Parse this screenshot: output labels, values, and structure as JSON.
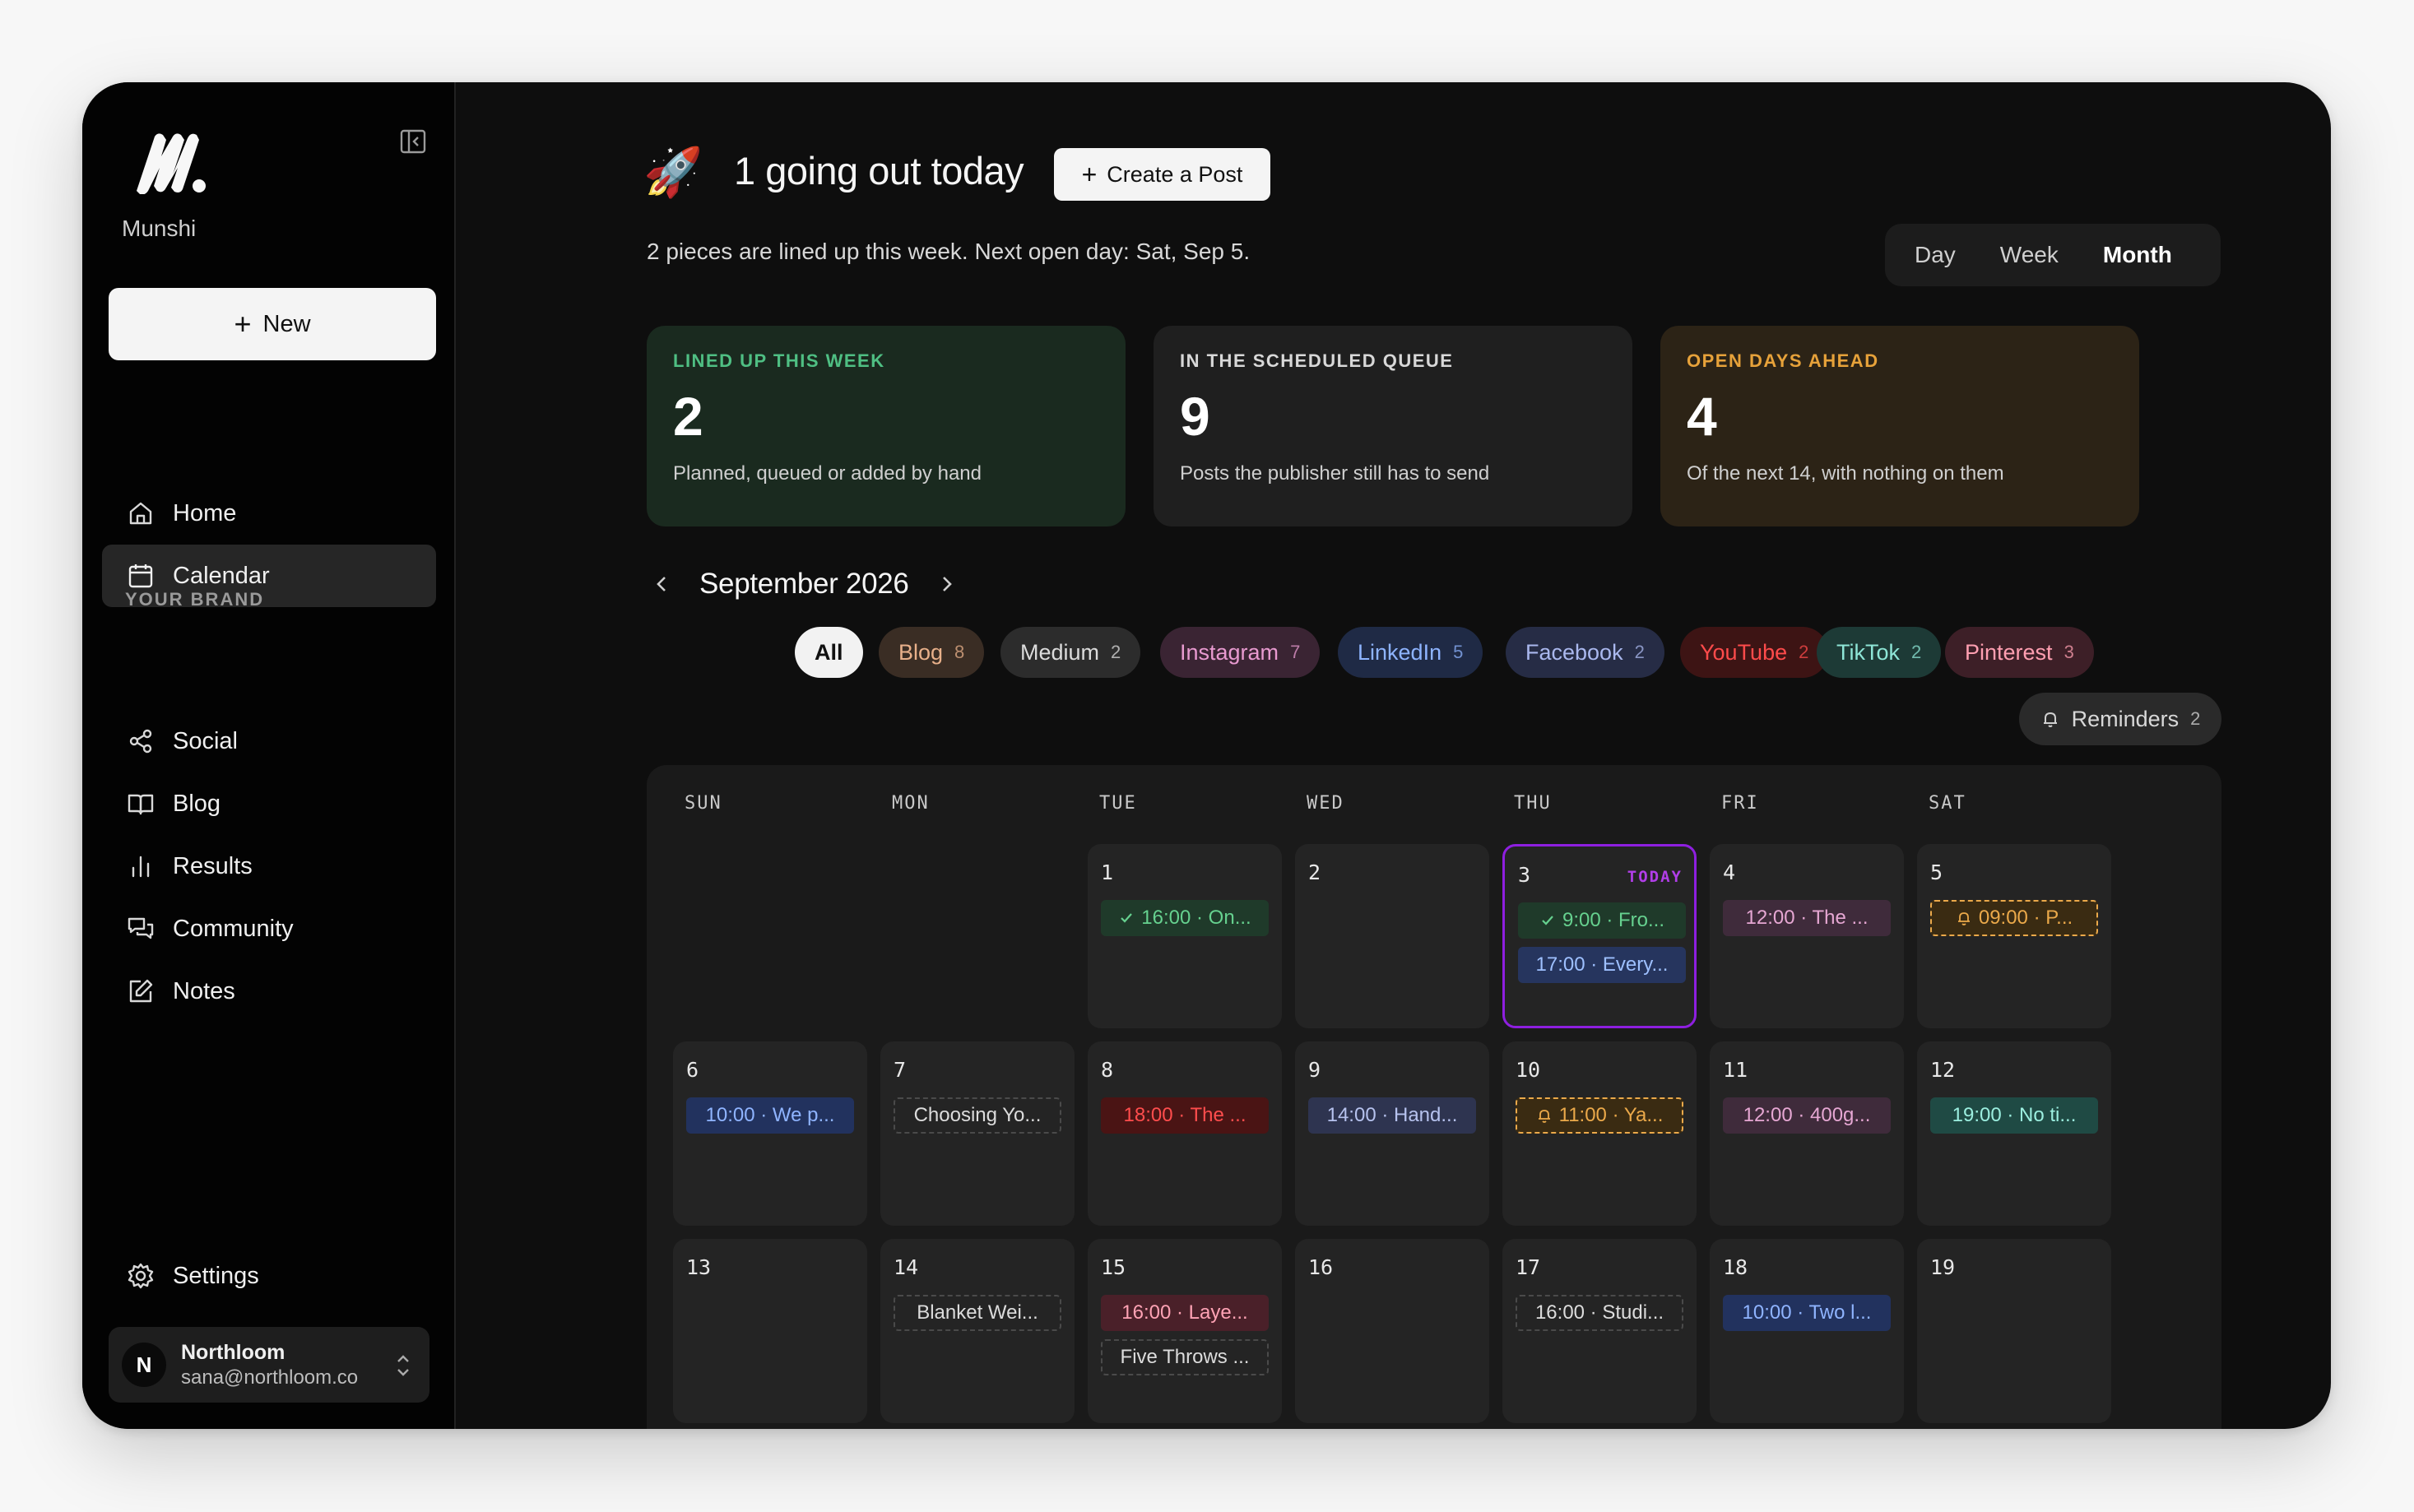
{
  "sidebar": {
    "brand_name": "Munshi",
    "new_label": "New",
    "nav": [
      {
        "label": "Home",
        "icon": "home-icon"
      },
      {
        "label": "Calendar",
        "icon": "calendar-icon",
        "active": true
      }
    ],
    "section_label": "YOUR BRAND",
    "brand_nav": [
      {
        "label": "Social",
        "icon": "share-icon"
      },
      {
        "label": "Blog",
        "icon": "book-icon"
      },
      {
        "label": "Results",
        "icon": "bar-chart-icon"
      },
      {
        "label": "Community",
        "icon": "chat-icon"
      },
      {
        "label": "Notes",
        "icon": "edit-icon"
      }
    ],
    "settings_label": "Settings",
    "account": {
      "initial": "N",
      "name": "Northloom",
      "email": "sana@northloom.co"
    }
  },
  "header": {
    "emoji": "🚀",
    "title": "1 going out today",
    "create_label": "Create a Post",
    "subtitle": "2 pieces are lined up this week. Next open day: Sat, Sep 5."
  },
  "view_switch": {
    "options": [
      "Day",
      "Week",
      "Month"
    ],
    "active": "Month"
  },
  "stats": [
    {
      "label": "LINED UP THIS WEEK",
      "value": "2",
      "desc": "Planned, queued or added by hand",
      "accent": "#4fbf83",
      "bg": "#1a2a1f"
    },
    {
      "label": "IN THE SCHEDULED QUEUE",
      "value": "9",
      "desc": "Posts the publisher still has to send",
      "accent": "#d8d8d8",
      "bg": "#1f1f1f"
    },
    {
      "label": "OPEN DAYS AHEAD",
      "value": "4",
      "desc": "Of the next 14, with nothing on them",
      "accent": "#e7a23a",
      "bg": "#2c2316"
    }
  ],
  "calendar": {
    "month_label": "September 2026",
    "filters": [
      {
        "label": "All",
        "count": "",
        "bg": "#f2f2f2",
        "fg": "#111"
      },
      {
        "label": "Blog",
        "count": "8",
        "bg": "#3a2d24",
        "fg": "#e8b08a"
      },
      {
        "label": "Medium",
        "count": "2",
        "bg": "#2c2c2c",
        "fg": "#dcdcdc"
      },
      {
        "label": "Instagram",
        "count": "7",
        "bg": "#3a2433",
        "fg": "#e89ad0"
      },
      {
        "label": "LinkedIn",
        "count": "5",
        "bg": "#1f2a45",
        "fg": "#8eb4ff"
      },
      {
        "label": "Facebook",
        "count": "2",
        "bg": "#262c45",
        "fg": "#aab8ee"
      },
      {
        "label": "YouTube",
        "count": "2",
        "bg": "#3d1414",
        "fg": "#ff4b4b"
      },
      {
        "label": "TikTok",
        "count": "2",
        "bg": "#1d3a36",
        "fg": "#8ee6d7"
      },
      {
        "label": "Pinterest",
        "count": "3",
        "bg": "#3d1f27",
        "fg": "#ff9fb1"
      }
    ],
    "reminders": {
      "label": "Reminders",
      "count": "2"
    },
    "weekdays": [
      "SUN",
      "MON",
      "TUE",
      "WED",
      "THU",
      "FRI",
      "SAT"
    ],
    "today_label": "TODAY",
    "weeks": [
      [
        null,
        null,
        {
          "day": "1",
          "events": [
            {
              "text": "16:00 · On...",
              "kind": "done",
              "bg": "#1f3a2a",
              "fg": "#66d18f"
            }
          ]
        },
        {
          "day": "2",
          "events": []
        },
        {
          "day": "3",
          "today": true,
          "events": [
            {
              "text": "9:00 · Fro...",
              "kind": "done",
              "bg": "#1f3a2a",
              "fg": "#66d18f"
            },
            {
              "text": "17:00 · Every...",
              "kind": "plain",
              "bg": "#26355e",
              "fg": "#9ec0ff"
            }
          ]
        },
        {
          "day": "4",
          "events": [
            {
              "text": "12:00 · The ...",
              "kind": "plain",
              "bg": "#3f2b3b",
              "fg": "#e6a7d3"
            }
          ]
        },
        {
          "day": "5",
          "events": [
            {
              "text": "09:00 · P...",
              "kind": "reminder",
              "bg": "#3a2b12",
              "fg": "#eba94a"
            }
          ]
        }
      ],
      [
        {
          "day": "6",
          "events": [
            {
              "text": "10:00 · We p...",
              "kind": "plain",
              "bg": "#22325e",
              "fg": "#8fb4ff"
            }
          ]
        },
        {
          "day": "7",
          "events": [
            {
              "text": "Choosing Yo...",
              "kind": "draft",
              "bg": "transparent",
              "fg": "#dcdcdc"
            }
          ]
        },
        {
          "day": "8",
          "events": [
            {
              "text": "18:00 · The ...",
              "kind": "plain",
              "bg": "#4a1414",
              "fg": "#ff4d4d"
            }
          ]
        },
        {
          "day": "9",
          "events": [
            {
              "text": "14:00 · Hand...",
              "kind": "plain",
              "bg": "#2e3450",
              "fg": "#b6c2ee"
            }
          ]
        },
        {
          "day": "10",
          "events": [
            {
              "text": "11:00 · Ya...",
              "kind": "reminder",
              "bg": "#3a2b12",
              "fg": "#eba94a"
            }
          ]
        },
        {
          "day": "11",
          "events": [
            {
              "text": "12:00 · 400g...",
              "kind": "plain",
              "bg": "#3f2b3b",
              "fg": "#e6a7d3"
            }
          ]
        },
        {
          "day": "12",
          "events": [
            {
              "text": "19:00 · No ti...",
              "kind": "plain",
              "bg": "#1f4a44",
              "fg": "#9beedf"
            }
          ]
        }
      ],
      [
        {
          "day": "13",
          "events": []
        },
        {
          "day": "14",
          "events": [
            {
              "text": "Blanket Wei...",
              "kind": "draft",
              "bg": "transparent",
              "fg": "#dcdcdc"
            }
          ]
        },
        {
          "day": "15",
          "events": [
            {
              "text": "16:00 · Laye...",
              "kind": "plain",
              "bg": "#4a2029",
              "fg": "#ffa3b5"
            },
            {
              "text": "Five Throws ...",
              "kind": "draft",
              "bg": "transparent",
              "fg": "#dcdcdc"
            }
          ]
        },
        {
          "day": "16",
          "events": []
        },
        {
          "day": "17",
          "events": [
            {
              "text": "16:00 · Studi...",
              "kind": "draft",
              "bg": "transparent",
              "fg": "#dcdcdc"
            }
          ]
        },
        {
          "day": "18",
          "events": [
            {
              "text": "10:00 · Two l...",
              "kind": "plain",
              "bg": "#22325e",
              "fg": "#8fb4ff"
            }
          ]
        },
        {
          "day": "19",
          "events": []
        }
      ]
    ]
  }
}
